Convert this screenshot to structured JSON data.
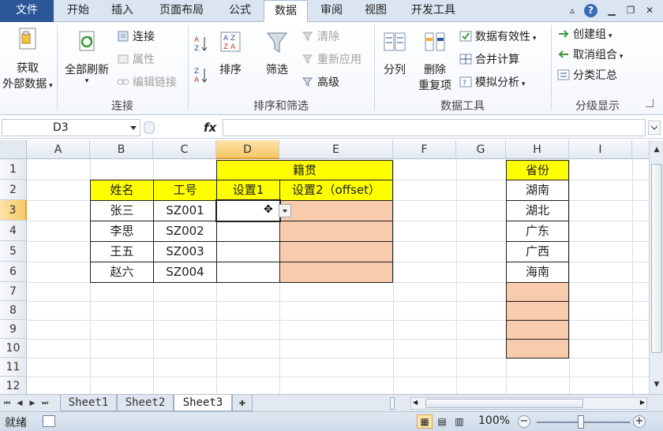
{
  "menu": {
    "file": "文件",
    "tabs": [
      "开始",
      "插入",
      "页面布局",
      "公式",
      "数据",
      "审阅",
      "视图",
      "开发工具"
    ],
    "active_tab": "数据"
  },
  "ribbon": {
    "groups": {
      "get_external": {
        "label_line1": "获取",
        "label_line2": "外部数据"
      },
      "connections": {
        "refresh_all": "全部刷新",
        "connections": "连接",
        "properties": "属性",
        "edit_links": "编辑链接",
        "group_label": "连接"
      },
      "sort_filter": {
        "sort": "排序",
        "filter": "筛选",
        "clear": "清除",
        "reapply": "重新应用",
        "advanced": "高级",
        "group_label": "排序和筛选"
      },
      "data_tools": {
        "text_to_columns": "分列",
        "remove_dup_line1": "删除",
        "remove_dup_line2": "重复项",
        "data_validation": "数据有效性",
        "consolidate": "合并计算",
        "what_if": "模拟分析",
        "group_label": "数据工具"
      },
      "outline": {
        "group": "创建组",
        "ungroup": "取消组合",
        "subtotal": "分类汇总",
        "group_label": "分级显示"
      }
    }
  },
  "formula_bar": {
    "name_box": "D3",
    "fx": "fx",
    "value": ""
  },
  "sheet": {
    "columns": [
      "A",
      "B",
      "C",
      "D",
      "E",
      "F",
      "G",
      "H",
      "I"
    ],
    "rows": [
      "1",
      "2",
      "3",
      "4",
      "5",
      "6",
      "7",
      "8",
      "9",
      "10",
      "11",
      "12"
    ],
    "selected_column": "D",
    "selected_row": "3",
    "table1": {
      "header_merged": "籍贯",
      "headers": [
        "姓名",
        "工号",
        "设置1",
        "设置2（offset）"
      ],
      "rows": [
        [
          "张三",
          "SZ001",
          "",
          ""
        ],
        [
          "李思",
          "SZ002",
          "",
          ""
        ],
        [
          "王五",
          "SZ003",
          "",
          ""
        ],
        [
          "赵六",
          "SZ004",
          "",
          ""
        ]
      ]
    },
    "table2": {
      "header": "省份",
      "values": [
        "湖南",
        "湖北",
        "广东",
        "广西",
        "海南",
        "",
        "",
        "",
        ""
      ]
    }
  },
  "sheet_tabs": {
    "tabs": [
      "Sheet1",
      "Sheet2",
      "Sheet3"
    ],
    "active": "Sheet3"
  },
  "status": {
    "ready": "就绪",
    "zoom": "100%"
  },
  "colors": {
    "header_yellow": "#ffff00",
    "fill_orange": "#f8cbad",
    "selected_header": "#f7c766",
    "file_tab": "#2b5797"
  }
}
